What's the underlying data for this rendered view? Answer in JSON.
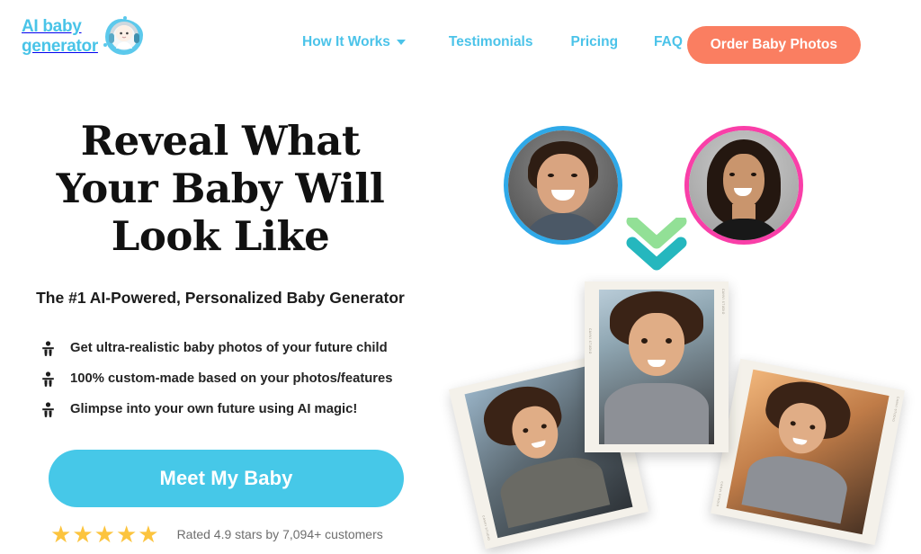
{
  "brand": {
    "name_line1": "AI baby",
    "name_line2": "generator",
    "logo_icon": "baby-headphones-logo",
    "accent_blue": "#49C4E8"
  },
  "nav": {
    "items": [
      {
        "label": "How It Works",
        "has_dropdown": true,
        "icon": "chevron-down-icon"
      },
      {
        "label": "Testimonials",
        "has_dropdown": false
      },
      {
        "label": "Pricing",
        "has_dropdown": false
      },
      {
        "label": "FAQ",
        "has_dropdown": false
      }
    ],
    "cta": {
      "label": "Order Baby Photos",
      "color": "#FA7E61"
    }
  },
  "hero": {
    "headline": "Reveal What Your Baby Will Look Like",
    "subheadline": "The #1 AI-Powered, Personalized Baby Generator",
    "features": [
      {
        "icon": "baby-icon",
        "text": "Get ultra-realistic baby photos of your future child"
      },
      {
        "icon": "baby-icon",
        "text": "100% custom-made based on your photos/features"
      },
      {
        "icon": "baby-icon",
        "text": "Glimpse into your own future using AI magic!"
      }
    ],
    "cta": {
      "label": "Meet My Baby",
      "color": "#46C8E8"
    },
    "rating": {
      "stars_filled": 5,
      "star_glyph": "★",
      "star_color": "#FCC43E",
      "text": "Rated 4.9 stars by 7,094+ customers"
    }
  },
  "visual": {
    "parents": [
      {
        "name": "father-portrait",
        "ring_color": "#2FA9E8"
      },
      {
        "name": "mother-portrait",
        "ring_color": "#F93FA8"
      }
    ],
    "arrow": {
      "icon": "double-chevron-down-icon",
      "top_color": "#92E096",
      "bottom_color": "#25B7BE"
    },
    "baby_photos": [
      {
        "name": "baby-photo-top",
        "film_label": "CANVI STUDIO"
      },
      {
        "name": "baby-photo-left",
        "film_label": "CANVI STUDIO"
      },
      {
        "name": "baby-photo-right",
        "film_label": "CANVI STUDIO"
      }
    ]
  }
}
